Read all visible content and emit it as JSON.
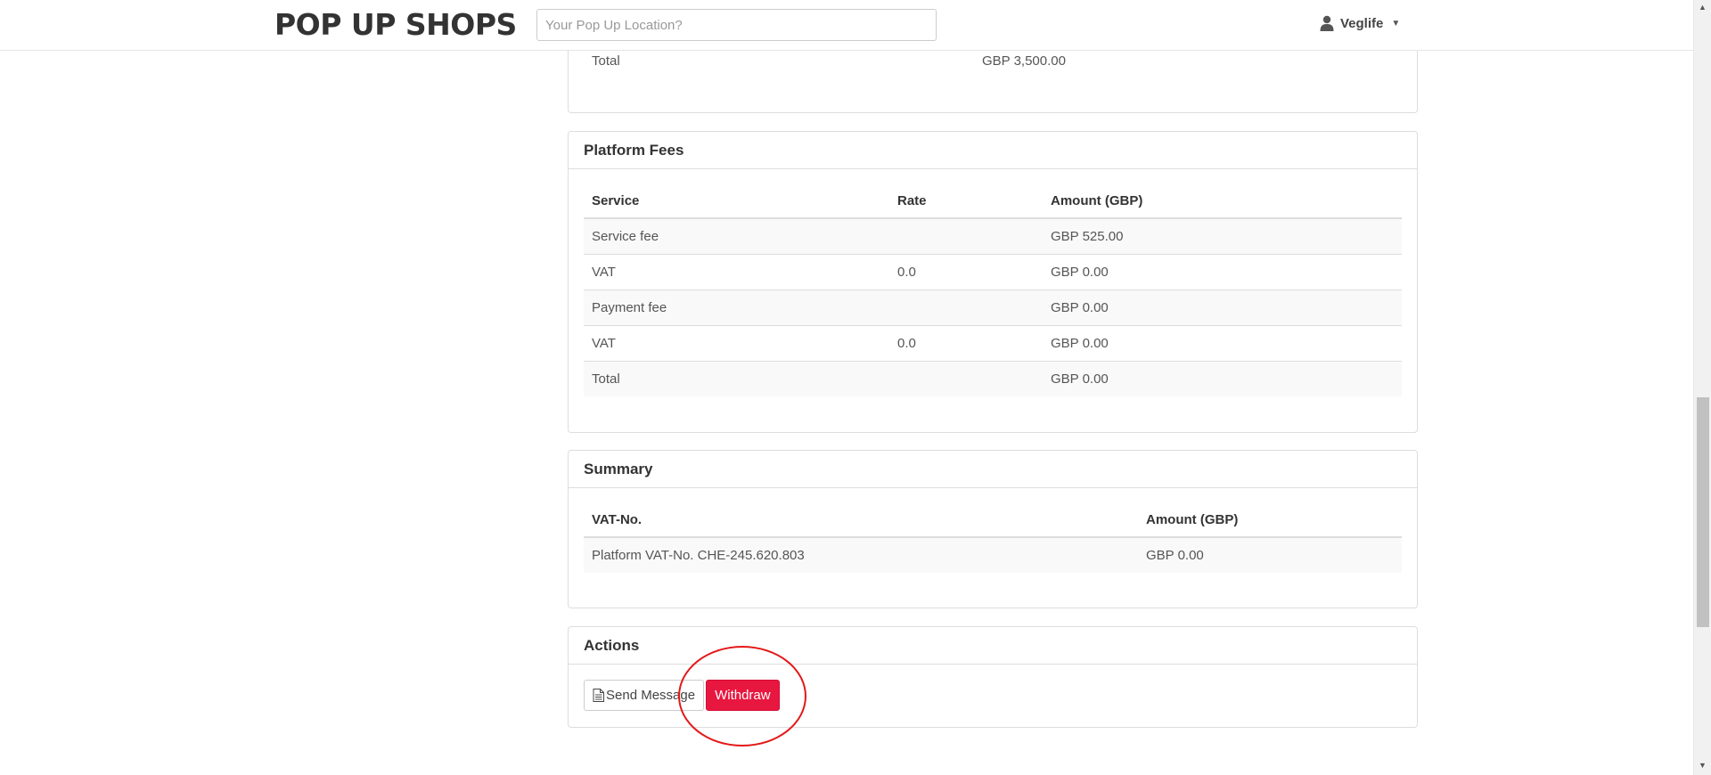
{
  "header": {
    "logo": "POP UP SHOPS",
    "search_placeholder": "Your Pop Up Location?",
    "user_name": "Veglife"
  },
  "top_panel": {
    "total_label": "Total",
    "total_value": "GBP 3,500.00"
  },
  "platform_fees": {
    "title": "Platform Fees",
    "columns": [
      "Service",
      "Rate",
      "Amount (GBP)"
    ],
    "rows": [
      [
        "Service fee",
        "",
        "GBP 525.00"
      ],
      [
        "VAT",
        "0.0",
        "GBP 0.00"
      ],
      [
        "Payment fee",
        "",
        "GBP 0.00"
      ],
      [
        "VAT",
        "0.0",
        "GBP 0.00"
      ],
      [
        "Total",
        "",
        "GBP 0.00"
      ]
    ]
  },
  "summary": {
    "title": "Summary",
    "columns": [
      "VAT-No.",
      "Amount (GBP)"
    ],
    "rows": [
      [
        "Platform VAT-No. CHE-245.620.803",
        "GBP 0.00"
      ]
    ]
  },
  "actions": {
    "title": "Actions",
    "send_message_label": "Send Message",
    "withdraw_label": "Withdraw"
  },
  "colors": {
    "accent": "#e8173f",
    "annotation": "#e31818"
  }
}
